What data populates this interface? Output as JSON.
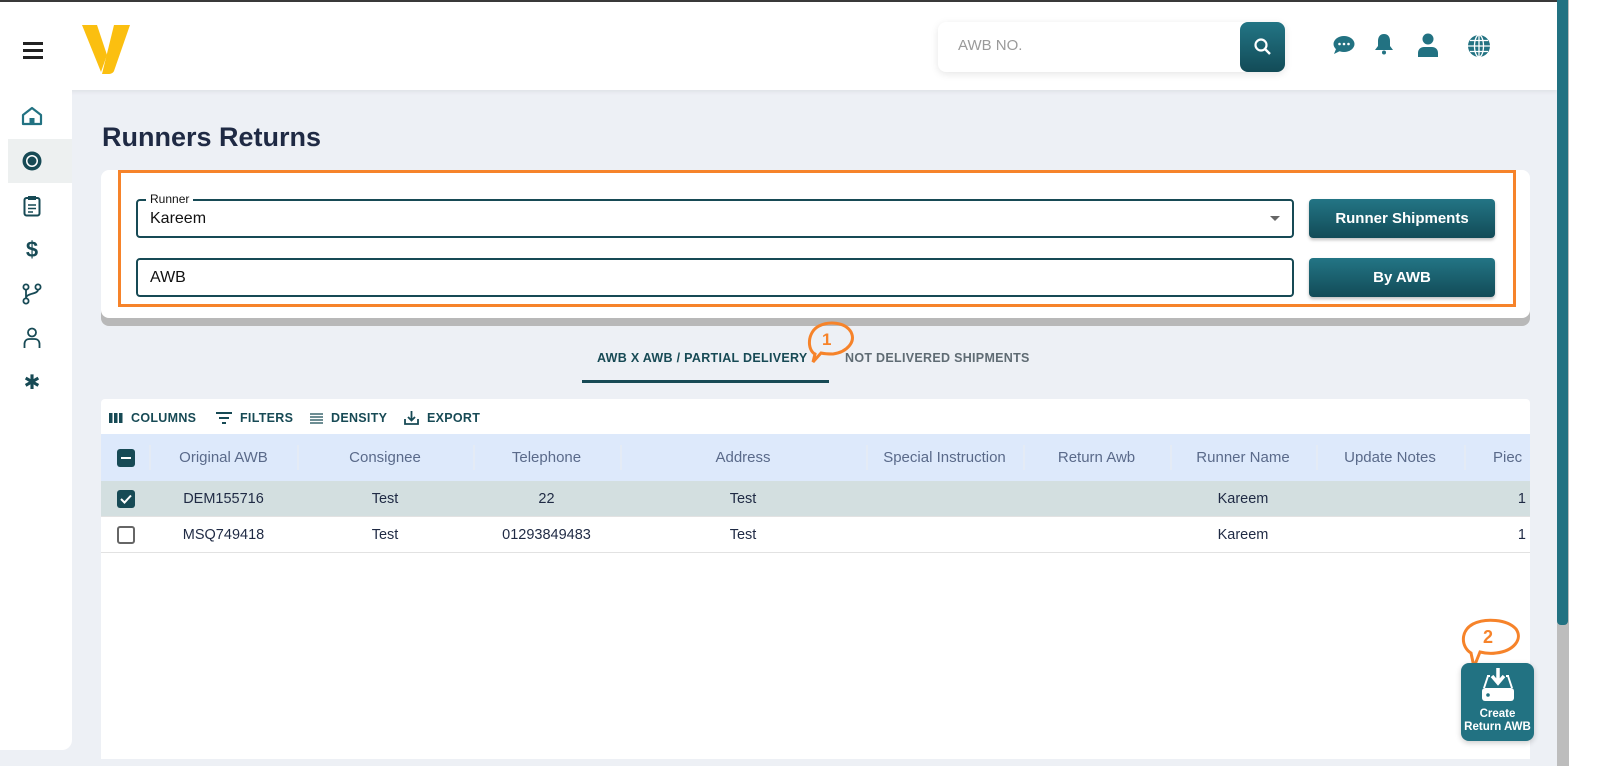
{
  "header": {
    "search_placeholder": "AWB NO.",
    "icons": [
      "chat-icon",
      "bell-icon",
      "user-icon",
      "globe-icon"
    ]
  },
  "sidebar": {
    "items": [
      "home-icon",
      "new-badge-icon",
      "clipboard-icon",
      "dollar-icon",
      "branch-icon",
      "person-icon",
      "gear-icon"
    ],
    "active": 1
  },
  "page": {
    "title": "Runners Returns"
  },
  "form": {
    "runner_label": "Runner",
    "runner_value": "Kareem",
    "awb_value": "AWB",
    "runner_shipments_label": "Runner Shipments",
    "by_awb_label": "By AWB"
  },
  "tabs": [
    {
      "label": "AWB X AWB / PARTIAL DELIVERY",
      "active": true
    },
    {
      "label": "NOT DELIVERED SHIPMENTS",
      "active": false
    }
  ],
  "annotations": [
    "1",
    "2"
  ],
  "toolbar": {
    "columns": "COLUMNS",
    "filters": "FILTERS",
    "density": "DENSITY",
    "export": "EXPORT"
  },
  "table": {
    "columns": [
      "Original AWB",
      "Consignee",
      "Telephone",
      "Address",
      "Special Instruction",
      "Return Awb",
      "Runner Name",
      "Update Notes",
      "Piec"
    ],
    "rows": [
      {
        "checked": true,
        "cells": [
          "DEM155716",
          "Test",
          "22",
          "Test",
          "",
          "",
          "Kareem",
          "",
          "1"
        ]
      },
      {
        "checked": false,
        "cells": [
          "MSQ749418",
          "Test",
          "01293849483",
          "Test",
          "",
          "",
          "Kareem",
          "",
          "1"
        ]
      }
    ]
  },
  "fab": {
    "line1": "Create",
    "line2": "Return AWB"
  },
  "colors": {
    "accent": "#227282",
    "dark": "#174a55",
    "highlight": "#f6832a",
    "logo": "#fbbf10"
  }
}
